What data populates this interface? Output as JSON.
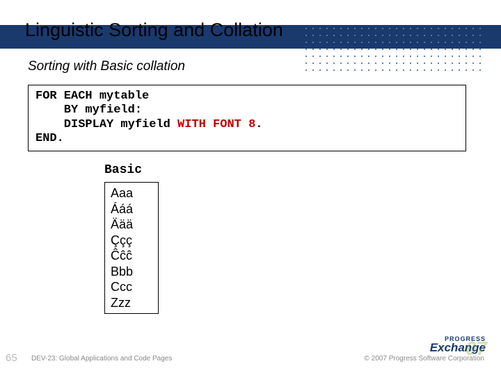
{
  "title": "Linguistic Sorting and Collation",
  "subtitle": "Sorting with Basic collation",
  "code": {
    "line1a": "FOR EACH mytable",
    "line2a": "    BY myfield:",
    "line3a": "    DISPLAY myfield ",
    "line3b": "WITH FONT 8",
    "line3c": ".",
    "line4a": "END."
  },
  "result_label": "Basic",
  "result_rows": [
    "Aaa",
    "Ááá",
    "Äää",
    "Ççç",
    "Ĉĉĉ",
    "Bbb",
    "Ccc",
    "Zzz"
  ],
  "slide_number": "65",
  "footer_left": "DEV-23: Global Applications and Code Pages",
  "footer_right": "© 2007 Progress Software Corporation",
  "logo": {
    "top": "PROGRESS",
    "main": "Exchange",
    "year": "07"
  }
}
